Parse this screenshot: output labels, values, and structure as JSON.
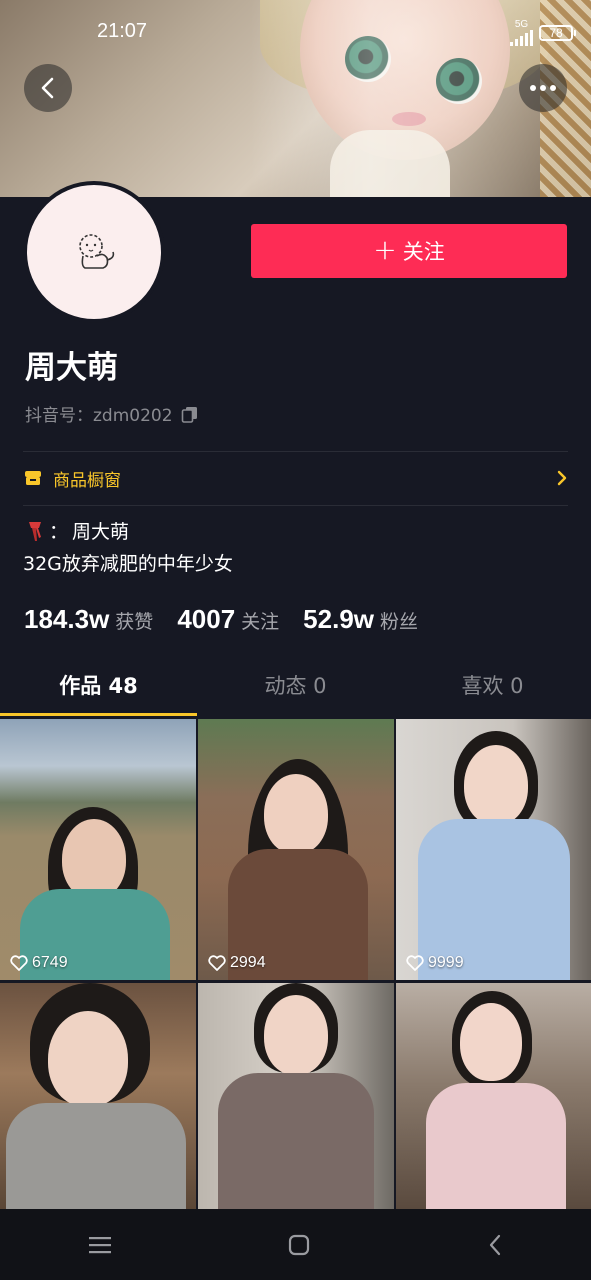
{
  "status_bar": {
    "time": "21:07",
    "network": "5G",
    "battery": "78"
  },
  "header": {
    "back_icon": "chevron-left-icon",
    "more_icon": "more-dots-icon"
  },
  "profile": {
    "follow_label": "关注",
    "name": "周大萌",
    "douyin_id_label": "抖音号：",
    "douyin_id": "zdm0202",
    "shop_label": "商品橱窗",
    "bio_line1_name": "周大萌",
    "bio_line1_sep": "：",
    "bio_line2": "32G放弃减肥的中年少女"
  },
  "stats": [
    {
      "value": "184.3w",
      "label": "获赞"
    },
    {
      "value": "4007",
      "label": "关注"
    },
    {
      "value": "52.9w",
      "label": "粉丝"
    }
  ],
  "tabs": [
    {
      "label": "作品 48",
      "active": true
    },
    {
      "label": "动态 0",
      "active": false
    },
    {
      "label": "喜欢 0",
      "active": false
    }
  ],
  "videos": [
    {
      "likes": "6749"
    },
    {
      "likes": "2994"
    },
    {
      "likes": "9999"
    },
    {
      "likes": ""
    },
    {
      "likes": ""
    },
    {
      "likes": ""
    }
  ],
  "colors": {
    "background": "#161823",
    "accent": "#fe2c55",
    "shop": "#f9c62a",
    "tab_indicator": "#f9c62a"
  }
}
